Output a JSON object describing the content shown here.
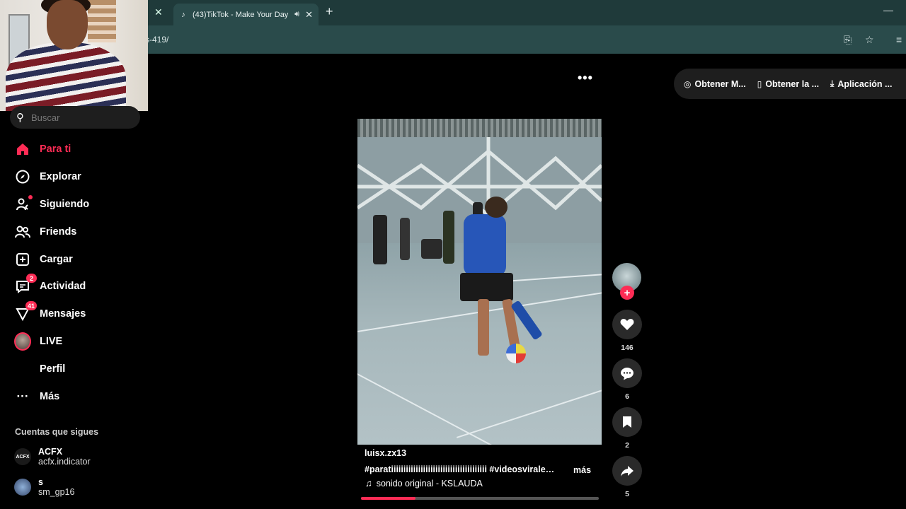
{
  "browser": {
    "tab_title": "(43)TikTok - Make Your Day",
    "url_fragment": "s-419/",
    "icons": [
      "close-icon",
      "tiktok-icon",
      "sound-icon",
      "plus-icon",
      "minimize-icon",
      "install-icon",
      "star-icon",
      "reading-list-icon"
    ]
  },
  "sidebar": {
    "search_placeholder": "Buscar",
    "items": [
      {
        "label": "Para ti",
        "icon": "home-icon",
        "active": true
      },
      {
        "label": "Explorar",
        "icon": "compass-icon"
      },
      {
        "label": "Siguiendo",
        "icon": "following-icon"
      },
      {
        "label": "Friends",
        "icon": "friends-icon"
      },
      {
        "label": "Cargar",
        "icon": "upload-icon"
      },
      {
        "label": "Actividad",
        "icon": "activity-icon",
        "badge": "2"
      },
      {
        "label": "Mensajes",
        "icon": "messages-icon",
        "badge": "41"
      },
      {
        "label": "LIVE",
        "icon": "live-avatar"
      },
      {
        "label": "Perfil",
        "icon": "profile-icon"
      },
      {
        "label": "Más",
        "icon": "more-icon"
      }
    ],
    "following_title": "Cuentas que sigues",
    "following": [
      {
        "name": "ACFX",
        "handle": "acfx.indicator",
        "avatar_text": "ACFX"
      },
      {
        "name": "s",
        "handle": "sm_gp16"
      }
    ]
  },
  "top_actions": [
    {
      "label": "Obtener M...",
      "icon": "coin-icon"
    },
    {
      "label": "Obtener la ...",
      "icon": "phone-icon"
    },
    {
      "label": "Aplicación ...",
      "icon": "download-icon"
    }
  ],
  "video": {
    "username": "luisx.zx13",
    "caption": "#paratiiiiiiiiiiiiiiiiiiiiiiiiiiiiiiiiiiiiiii  #videosvirales  ...",
    "more_label": "más",
    "sound": "sonido original - KSLAUDA",
    "progress": 0.23
  },
  "actions": {
    "likes": "146",
    "comments": "6",
    "saves": "2",
    "shares": "5"
  },
  "colors": {
    "accent": "#fe2c55",
    "chrome_dark": "#1f3a3a",
    "chrome_light": "#2a4b4b"
  }
}
